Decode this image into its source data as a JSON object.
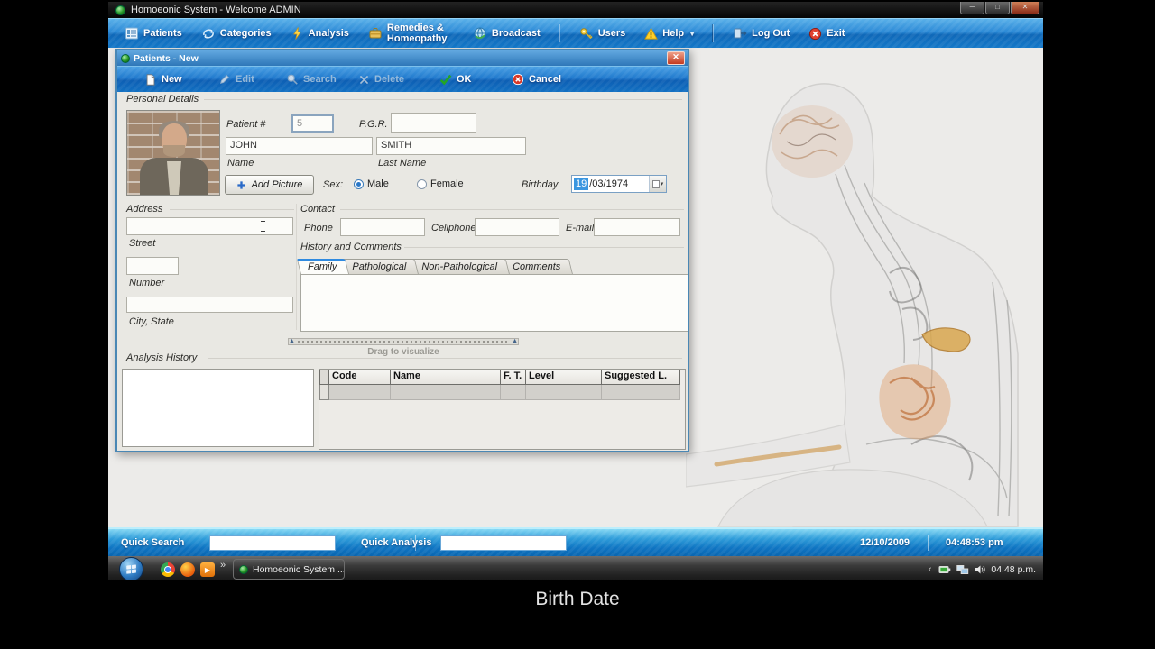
{
  "window": {
    "title": "Homoeonic System - Welcome ADMIN",
    "controls": {
      "minimize": "─",
      "maximize": "□",
      "close": "✕"
    }
  },
  "main_toolbar": {
    "items": [
      {
        "label": "Patients",
        "icon": "patients-icon"
      },
      {
        "label": "Categories",
        "icon": "categories-icon"
      },
      {
        "label": "Analysis",
        "icon": "analysis-icon"
      },
      {
        "label": "Remedies & Homeopathy",
        "icon": "remedies-icon"
      },
      {
        "label": "Broadcast",
        "icon": "broadcast-icon"
      },
      {
        "label": "Users",
        "icon": "users-icon"
      },
      {
        "label": "Help",
        "icon": "help-icon"
      },
      {
        "label": "Log Out",
        "icon": "logout-icon"
      },
      {
        "label": "Exit",
        "icon": "exit-icon"
      }
    ]
  },
  "dialog": {
    "title": "Patients - New",
    "toolbar": [
      {
        "label": "New",
        "enabled": true
      },
      {
        "label": "Edit",
        "enabled": false
      },
      {
        "label": "Search",
        "enabled": false
      },
      {
        "label": "Delete",
        "enabled": false
      },
      {
        "label": "OK",
        "enabled": true
      },
      {
        "label": "Cancel",
        "enabled": true
      }
    ],
    "personal_details": {
      "section_label": "Personal Details",
      "patient_number_label": "Patient #",
      "patient_number": "5",
      "pgr_label": "P.G.R.",
      "pgr_value": "",
      "first_name": "JOHN",
      "first_name_label": "Name",
      "last_name": "SMITH",
      "last_name_label": "Last Name",
      "add_picture_label": "Add Picture",
      "sex_label": "Sex:",
      "sex_options": [
        "Male",
        "Female"
      ],
      "sex_selected": "Male",
      "birthday_label": "Birthday",
      "birthday_day": "19",
      "birthday_rest": "/03/1974"
    },
    "address": {
      "section_label": "Address",
      "street_value": "",
      "street_label": "Street",
      "number_value": "",
      "number_label": "Number",
      "city_value": "",
      "city_label": "City, State"
    },
    "contact": {
      "section_label": "Contact",
      "phone_label": "Phone",
      "phone_value": "",
      "cellphone_label": "Cellphone",
      "cellphone_value": "",
      "email_label": "E-mail",
      "email_value": ""
    },
    "history": {
      "section_label": "History and Comments",
      "tabs": [
        "Family",
        "Pathological",
        "Non-Pathological",
        "Comments"
      ],
      "active_tab": "Family",
      "content": ""
    },
    "splitter_label": "Drag to visualize",
    "analysis_history": {
      "section_label": "Analysis History",
      "columns": [
        "Code",
        "Name",
        "F. T.",
        "Level",
        "Suggested L."
      ],
      "rows": []
    }
  },
  "status_bar": {
    "quick_search_label": "Quick Search",
    "quick_search_value": "",
    "quick_analysis_label": "Quick Analysis",
    "quick_analysis_value": "",
    "date": "12/10/2009",
    "time": "04:48:53 pm"
  },
  "taskbar": {
    "overflow_glyph": "»",
    "task_button_label": "Homoeonic System ...",
    "tray_chevron": "‹",
    "tray_time": "04:48 p.m."
  },
  "caption": "Birth Date",
  "colors": {
    "toolbar_blue": "#1b76c8",
    "titlebar_black": "#0c0c0c",
    "dialog_border": "#4a87b4",
    "selection_blue": "#3a96e0",
    "status_blue": "#1785cc",
    "client_bg": "#ecebe9",
    "accent_red": "#d83828",
    "accent_green": "#1f9e1f"
  }
}
